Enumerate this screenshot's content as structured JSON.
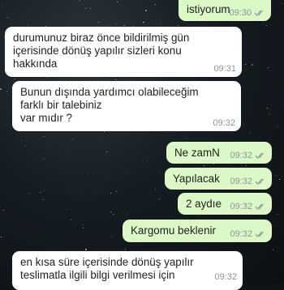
{
  "chat": {
    "messages": [
      {
        "id": "m1",
        "direction": "out",
        "text": "istiyorum",
        "time": "09:30",
        "status": "read-ticks-icon"
      },
      {
        "id": "m2",
        "direction": "in",
        "text": "durumunuz biraz önce bildirilmiş gün\niçerisinde dönüş yapılır sizleri konu\nhakkında",
        "time": "09:31"
      },
      {
        "id": "m3",
        "direction": "in",
        "text": "Bunun dışında yardımcı olabileceğim\nfarklı bir talebiniz\n var mıdır ?",
        "time": "09:32"
      },
      {
        "id": "m4",
        "direction": "out",
        "text": "Ne zamN",
        "time": "09:32",
        "status": "read-ticks-icon"
      },
      {
        "id": "m5",
        "direction": "out",
        "text": "Yapılacak",
        "time": "09:32",
        "status": "read-ticks-icon"
      },
      {
        "id": "m6",
        "direction": "out",
        "text": "2 aydıe",
        "time": "09:32",
        "status": "read-ticks-icon"
      },
      {
        "id": "m7",
        "direction": "out",
        "text": "Kargomu beklenir",
        "time": "09:32",
        "status": "read-ticks-icon"
      },
      {
        "id": "m8",
        "direction": "in",
        "text": "en kısa süre içerisinde dönüş yapılır\nteslimatla ilgili bilgi verilmesi için",
        "time": "09:32"
      }
    ]
  },
  "colors": {
    "incoming_bubble": "#ffffff",
    "outgoing_bubble": "#dcf8c6",
    "timestamp": "#8c969b",
    "ticks": "#8c969b"
  }
}
